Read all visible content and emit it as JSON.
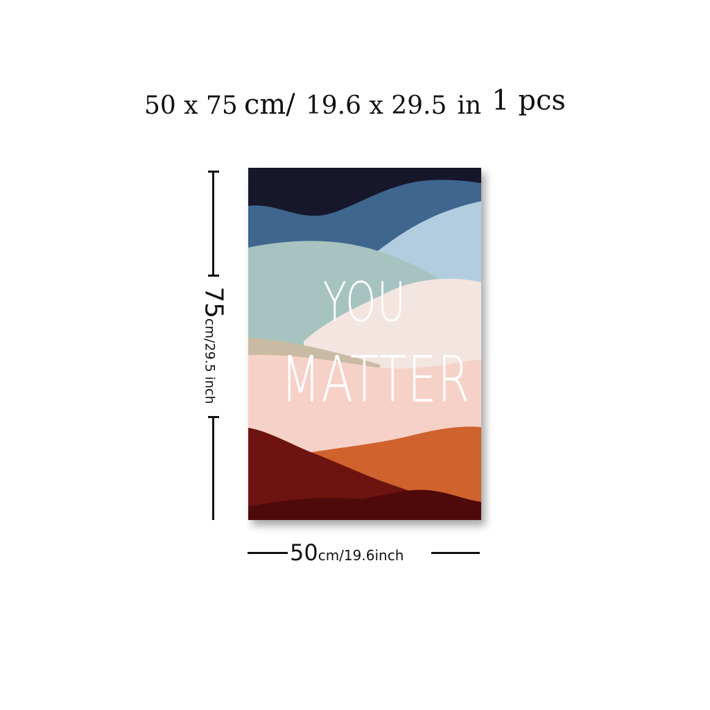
{
  "headline": {
    "metric": "50 x 75",
    "metric_unit": "cm/",
    "imperial": "19.6  x  29.5",
    "imperial_unit": "in",
    "quantity": "1 pcs"
  },
  "poster": {
    "line1": "YOU",
    "line2": "MATTER",
    "colors": {
      "navy": "#17172b",
      "blue": "#3f668f",
      "light_blue": "#b3cde0",
      "sage": "#a6c3bf",
      "blush": "#f3e5e0",
      "tan": "#c9bba3",
      "pink": "#f6d1c8",
      "orange": "#d0622e",
      "dark_red": "#6e1410",
      "maroon": "#4e0a0a"
    }
  },
  "dimensions": {
    "height_value": "75",
    "height_unit": "cm/29.5 inch",
    "width_value": "50",
    "width_unit": "cm/19.6inch"
  }
}
